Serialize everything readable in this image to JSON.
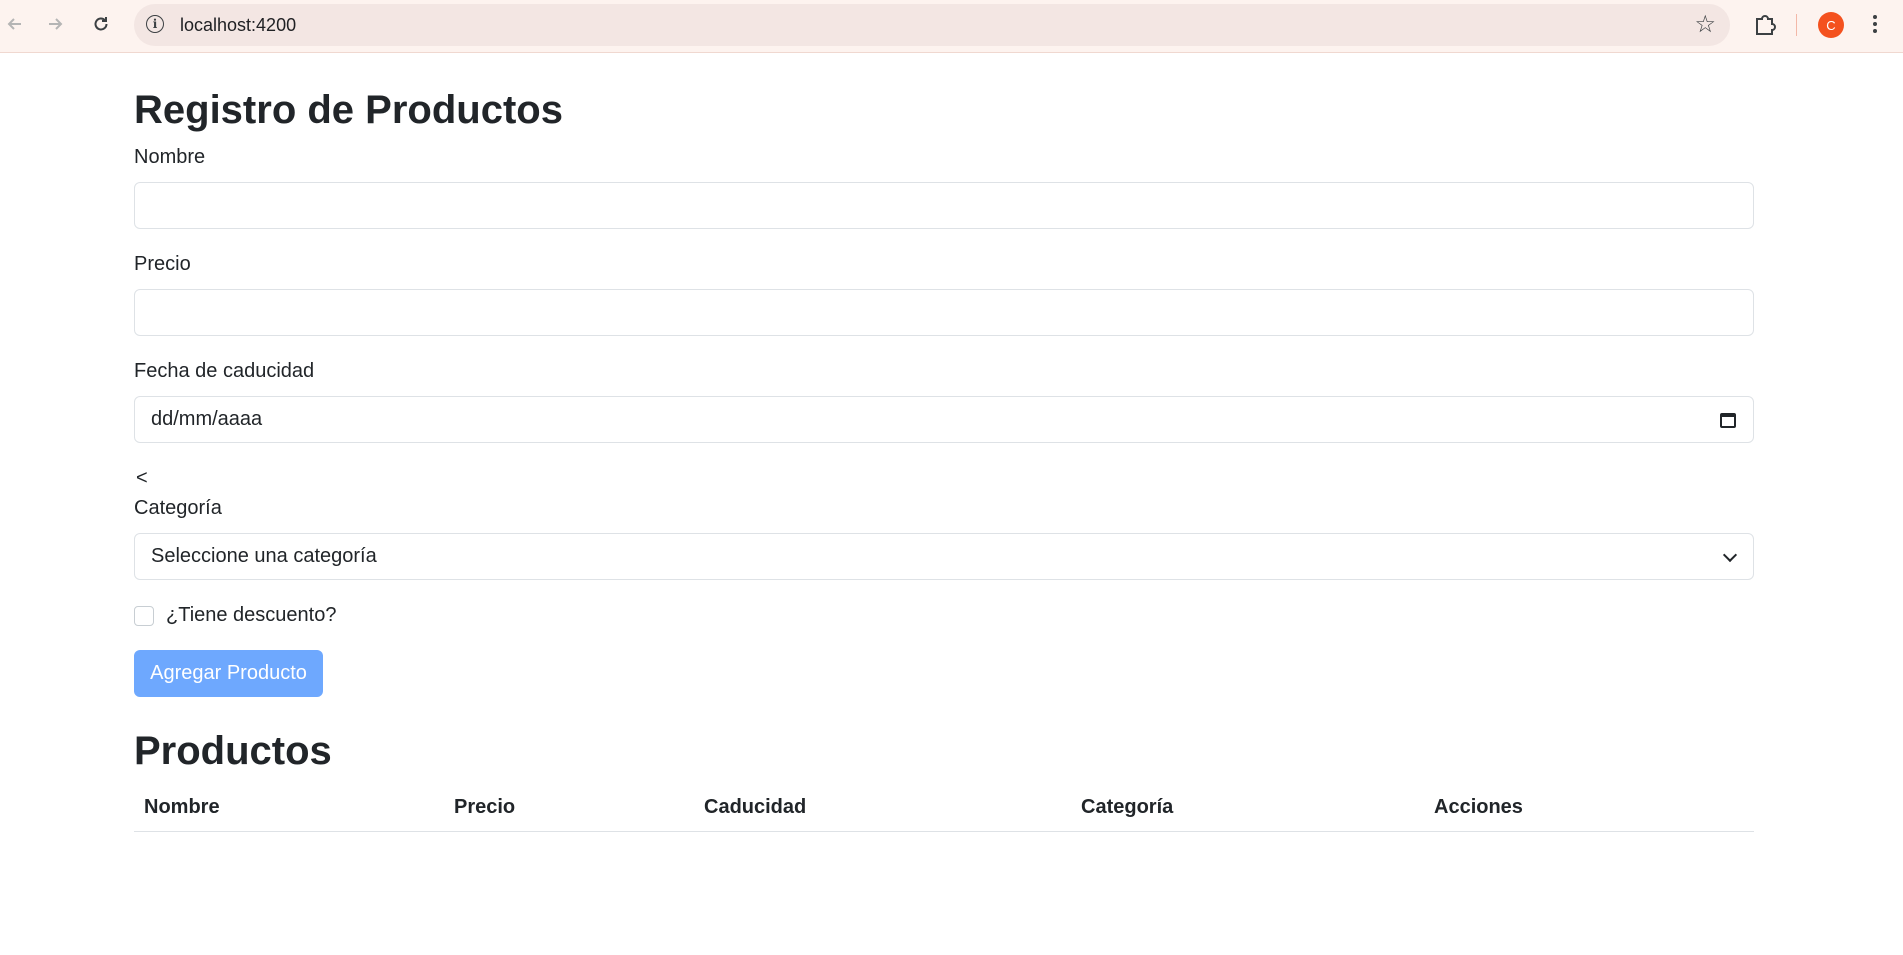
{
  "browser": {
    "url": "localhost:4200",
    "profile_initial": "C",
    "icons": {
      "back": "back-arrow-icon",
      "forward": "forward-arrow-icon",
      "reload": "reload-icon",
      "info": "info-icon",
      "bookmark": "star-icon",
      "extensions": "puzzle-icon",
      "menu": "kebab-menu-icon"
    },
    "colors": {
      "avatar": "#f4511e",
      "toolbar": "#fdf3ef"
    }
  },
  "form": {
    "title": "Registro de Productos",
    "nombre_label": "Nombre",
    "nombre_value": "",
    "precio_label": "Precio",
    "precio_value": "",
    "fecha_label": "Fecha de caducidad",
    "fecha_placeholder": "dd/mm/aaaa",
    "stray_text": "<",
    "categoria_label": "Categoría",
    "categoria_selected": "Seleccione una categoría",
    "descuento_label": "¿Tiene descuento?",
    "descuento_checked": false,
    "submit_label": "Agregar Producto",
    "submit_color": "#6ea8fe"
  },
  "products": {
    "title": "Productos",
    "columns": [
      "Nombre",
      "Precio",
      "Caducidad",
      "Categoría",
      "Acciones"
    ],
    "rows": []
  }
}
